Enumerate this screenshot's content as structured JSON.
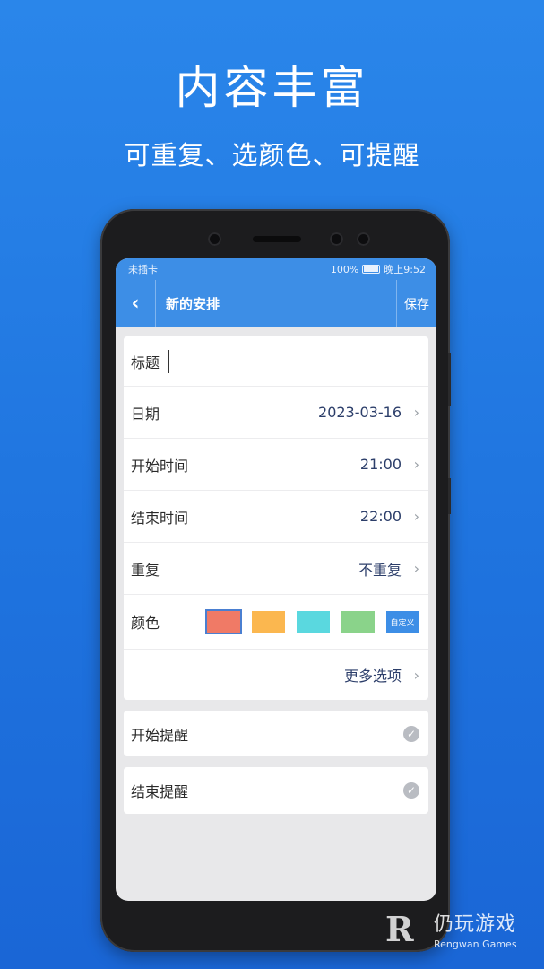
{
  "promo": {
    "headline": "内容丰富",
    "subline": "可重复、选颜色、可提醒"
  },
  "statusbar": {
    "left": "未插卡",
    "battery": "100%",
    "time": "晚上9:52"
  },
  "appbar": {
    "back_icon": "‹",
    "title": "新的安排",
    "save_label": "保存"
  },
  "form": {
    "title_label": "标题",
    "title_value": "",
    "date_label": "日期",
    "date_value": "2023-03-16",
    "start_time_label": "开始时间",
    "start_time_value": "21:00",
    "end_time_label": "结束时间",
    "end_time_value": "22:00",
    "repeat_label": "重复",
    "repeat_value": "不重复",
    "color_label": "颜色",
    "colors": [
      "#f07a66",
      "#fbb74f",
      "#5ad8df",
      "#8ad38a"
    ],
    "selected_color": "#f07a66",
    "custom_label": "自定义",
    "more_options_label": "更多选项"
  },
  "reminders": {
    "start_label": "开始提醒",
    "end_label": "结束提醒"
  },
  "watermark": {
    "logo": "R",
    "cn": "仍玩游戏",
    "en": "Rengwan Games"
  }
}
